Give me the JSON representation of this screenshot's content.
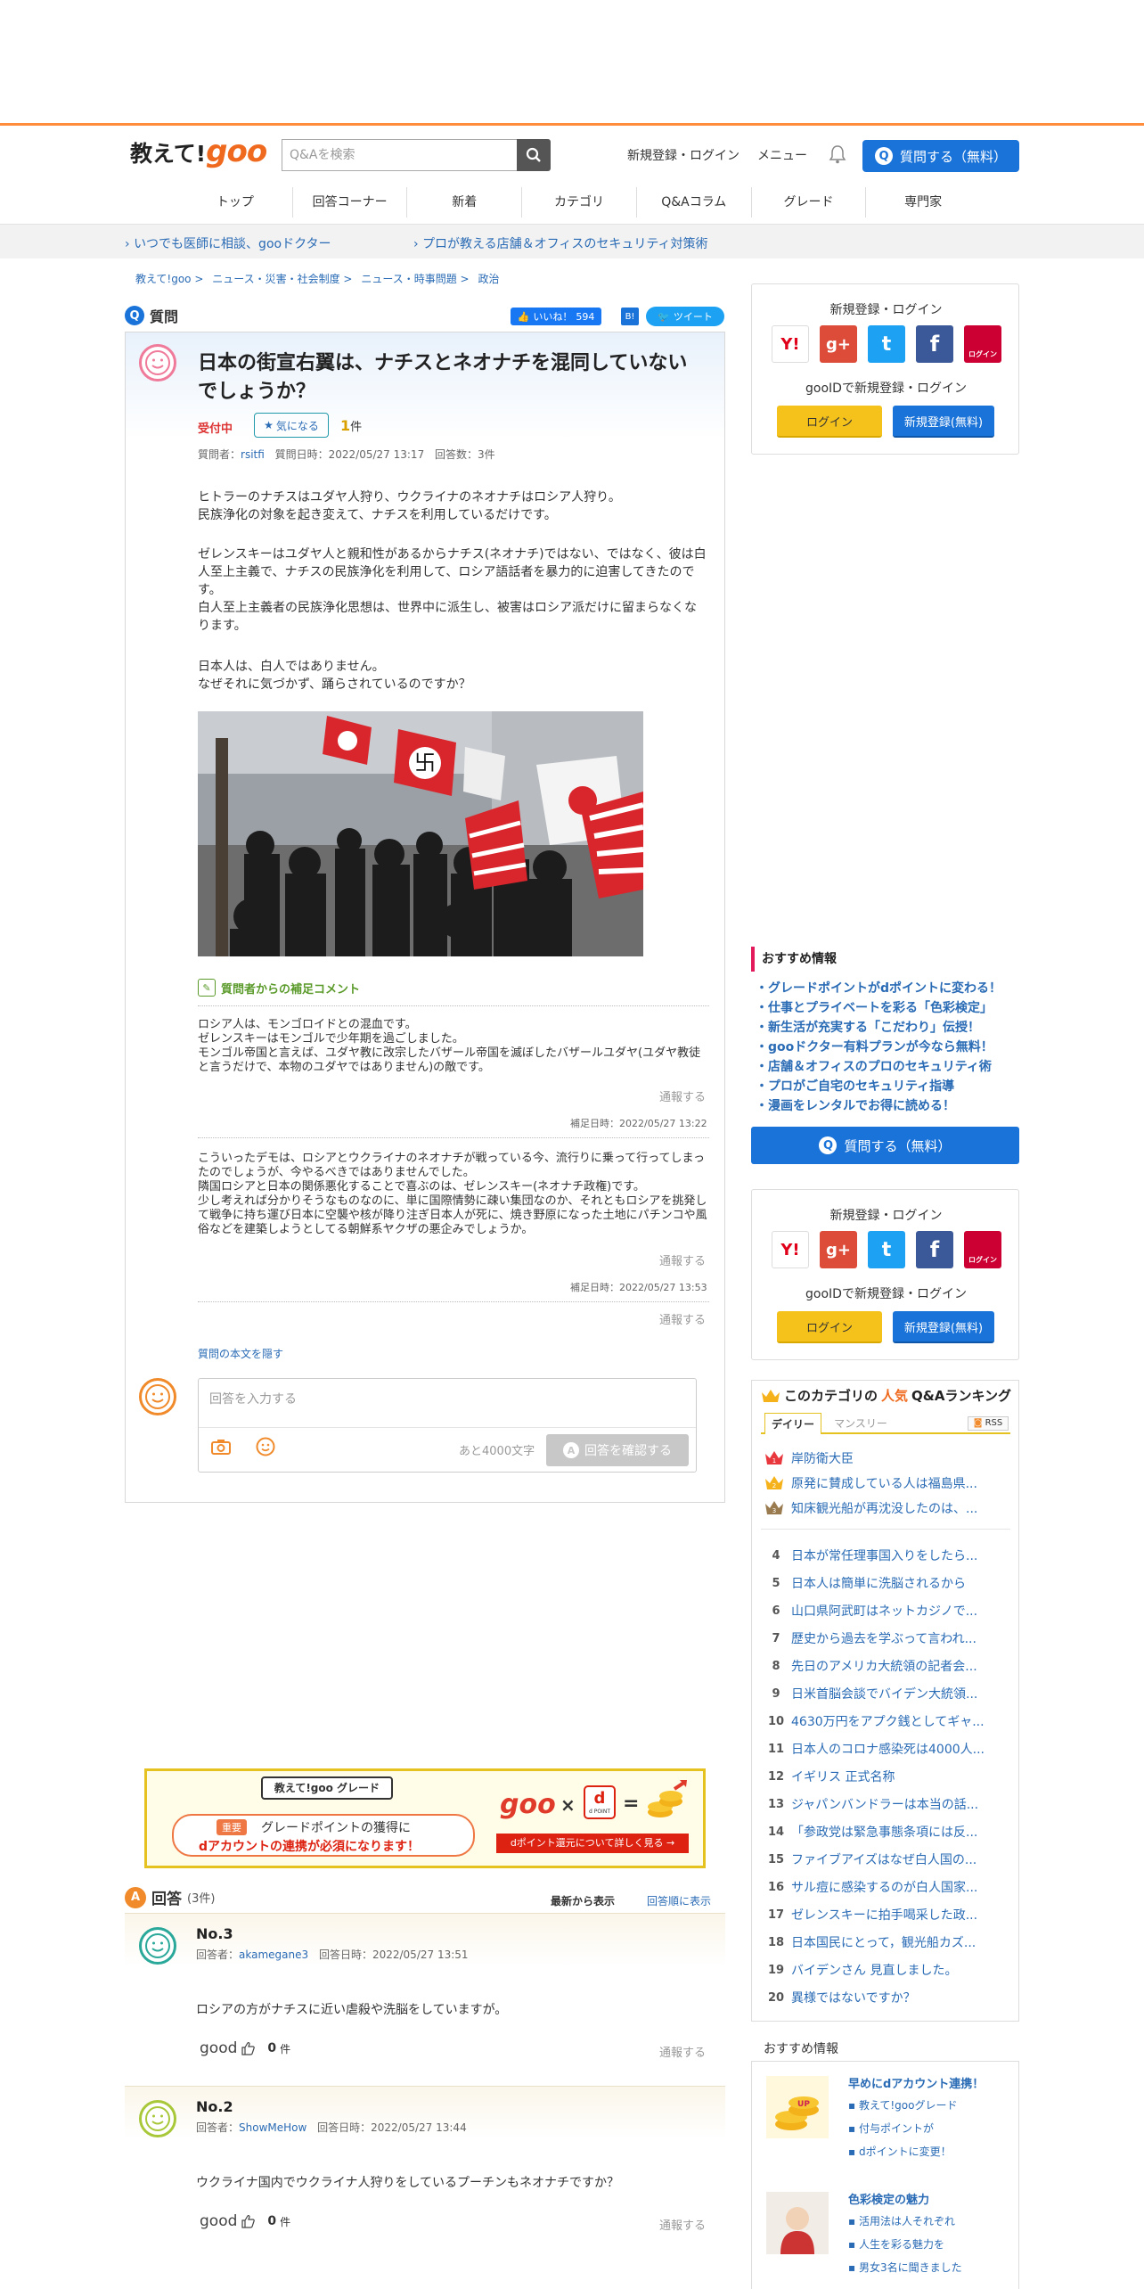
{
  "header": {
    "logo_text": "教えて!",
    "logo_goo": "goo",
    "search_placeholder": "Q&Aを検索",
    "login_label": "新規登録・ログイン",
    "menu_label": "メニュー",
    "ask_label": "質問する（無料）"
  },
  "gnav": [
    "トップ",
    "回答コーナー",
    "新着",
    "カテゴリ",
    "Q&Aコラム",
    "グレード",
    "専門家"
  ],
  "subbar": [
    "いつでも医師に相談、gooドクター",
    "プロが教える店舗＆オフィスのセキュリティ対策術"
  ],
  "breadcrumb": [
    "教えて!goo >",
    "ニュース・災害・社会制度 >",
    "ニュース・時事問題 >",
    "政治"
  ],
  "question": {
    "heading": "質問",
    "like_label": "いいね！",
    "like_count": "594",
    "hatena_label": "B!",
    "tweet_label": "ツイート",
    "title": "日本の街宣右翼は、ナチスとネオナチを混同していないでしょうか？",
    "status": "受付中",
    "watch_label": "気になる",
    "watch_count": "1",
    "watch_unit": "件",
    "meta_asker_label": "質問者：",
    "meta_asker": "rsitfi",
    "meta_date": "質問日時：2022/05/27 13:17",
    "meta_answers": "回答数：3件",
    "body1": "ヒトラーのナチスはユダヤ人狩り、ウクライナのネオナチはロシア人狩り。\n民族浄化の対象を起き変えて、ナチスを利用しているだけです。",
    "body2": "ゼレンスキーはユダヤ人と親和性があるからナチス(ネオナチ)ではない、ではなく、彼は白人至上主義で、ナチスの民族浄化を利用して、ロシア語話者を暴力的に迫害してきたのです。\n白人至上主義者の民族浄化思想は、世界中に派生し、被害はロシア派だけに留まらなくなります。",
    "body3": "日本人は、白人ではありません。\nなぜそれに気づかず、踊らされているのですか？",
    "supplement_heading": "質問者からの補足コメント",
    "supp1": "ロシア人は、モンゴロイドとの混血です。\nゼレンスキーはモンゴルで少年期を過ごしました。\nモンゴル帝国と言えば、ユダヤ教に改宗したバザール帝国を滅ぼしたバザールユダヤ(ユダヤ教徒と言うだけで、本物のユダヤではありません)の敵です。",
    "supp1_date": "補足日時：2022/05/27 13:22",
    "supp2": "こういったデモは、ロシアとウクライナのネオナチが戦っている今、流行りに乗って行ってしまったのでしょうが、今やるべきではありませんでした。\n隣国ロシアと日本の関係悪化することで喜ぶのは、ゼレンスキー(ネオナチ政権)です。\n少し考えれば分かりそうなものなのに、単に国際情勢に疎い集団なのか、それともロシアを挑発して戦争に持ち運び日本に空襲や核が降り注ぎ日本人が死に、焼き野原になった土地にパチンコや風俗などを建築しようとしてる朝鮮系ヤクザの悪企みでしょうか。",
    "supp2_date": "補足日時：2022/05/27 13:53",
    "report_label": "通報する",
    "hide_label": "質問の本文を隠す",
    "reply_placeholder": "回答を入力する",
    "reply_limit": "あと4000文字",
    "reply_confirm": "回答を確認する"
  },
  "grade_banner": {
    "logo": "教えて!goo グレード",
    "badge": "重要",
    "line1": "グレードポイントの獲得に",
    "line2": "dアカウントの連携が必須になります！",
    "goo": "goo",
    "times": "×",
    "equals": "=",
    "dpoint": "d POINT",
    "cta": "dポイント還元について詳しく見る →",
    "up": "UP"
  },
  "answers": {
    "heading": "回答",
    "count": "(3件)",
    "sort_new": "最新から表示",
    "sort_old": "回答順に表示",
    "items": [
      {
        "no": "No.3",
        "user_label": "回答者：",
        "user": "akamegane3",
        "date": "回答日時：2022/05/27 13:51",
        "text": "ロシアの方がナチスに近い虐殺や洗脳をしていますが。",
        "good_label": "good",
        "good_count": "0",
        "good_unit": "件",
        "report": "通報する"
      },
      {
        "no": "No.2",
        "user_label": "回答者：",
        "user": "ShowMeHow",
        "date": "回答日時：2022/05/27 13:44",
        "text": "ウクライナ国内でウクライナ人狩りをしているプーチンもネオナチですか？",
        "good_label": "good",
        "good_count": "0",
        "good_unit": "件",
        "report": "通報する"
      }
    ]
  },
  "sidebar": {
    "login_title": "新規登録・ログイン",
    "gooid_title": "gooIDで新規登録・ログイン",
    "login_btn": "ログイン",
    "register_btn": "新規登録(無料)",
    "sns": {
      "yahoo": "Y!",
      "google": "g+",
      "twitter": "t",
      "facebook": "f",
      "docomo": "ログイン"
    },
    "rec_heading": "おすすめ情報",
    "rec_items": [
      "・グレードポイントがdポイントに変わる！",
      "・仕事とプライベートを彩る「色彩検定」",
      "・新生活が充実する「こだわり」伝授！",
      "・gooドクター有料プランが今なら無料！",
      "・店舗＆オフィスのプロのセキュリティ術",
      "・プロがご自宅のセキュリティ指導",
      "・漫画をレンタルでお得に読める！"
    ],
    "ask_label": "質問する（無料）",
    "ranking_prefix": "このカテゴリの",
    "ranking_hl": "人気",
    "ranking_suffix": "Q&Aランキング",
    "tab_daily": "デイリー",
    "tab_monthly": "マンスリー",
    "rss": "RSS",
    "ranking": [
      {
        "n": "1",
        "t": "岸防衛大臣"
      },
      {
        "n": "2",
        "t": "原発に賛成している人は福島県..."
      },
      {
        "n": "3",
        "t": "知床観光船が再沈没したのは、..."
      },
      {
        "n": "4",
        "t": "日本が常任理事国入りをしたら..."
      },
      {
        "n": "5",
        "t": "日本人は簡単に洗脳されるから"
      },
      {
        "n": "6",
        "t": "山口県阿武町はネットカジノで..."
      },
      {
        "n": "7",
        "t": "歴史から過去を学ぶって言われ..."
      },
      {
        "n": "8",
        "t": "先日のアメリカ大統領の記者会..."
      },
      {
        "n": "9",
        "t": "日米首脳会談でバイデン大統領..."
      },
      {
        "n": "10",
        "t": "4630万円をアプク銭としてギャ..."
      },
      {
        "n": "11",
        "t": "日本人のコロナ感染死は4000人..."
      },
      {
        "n": "12",
        "t": "イギリス 正式名称"
      },
      {
        "n": "13",
        "t": "ジャパンバンドラーは本当の話..."
      },
      {
        "n": "14",
        "t": "「参政党は緊急事態条項には反..."
      },
      {
        "n": "15",
        "t": "ファイブアイズはなぜ白人国の..."
      },
      {
        "n": "16",
        "t": "サル痘に感染するのが白人国家..."
      },
      {
        "n": "17",
        "t": "ゼレンスキーに拍手喝采した政..."
      },
      {
        "n": "18",
        "t": "日本国民にとって，観光船カズ..."
      },
      {
        "n": "19",
        "t": "バイデンさん 見直しました。"
      },
      {
        "n": "20",
        "t": "異様ではないですか？"
      }
    ],
    "rec2_heading": "おすすめ情報",
    "rec2": [
      {
        "title": "早めにdアカウント連携！",
        "subs": [
          "教えて!gooグレード",
          "付与ポイントが",
          "dポイントに変更！"
        ]
      },
      {
        "title": "色彩検定の魅力",
        "subs": [
          "活用法は人それぞれ",
          "人生を彩る魅力を",
          "男女3名に聞きました"
        ]
      }
    ]
  },
  "colors": {
    "accent_orange": "#ef6a1e",
    "brand_blue": "#1a73d9",
    "login_yellow": "#f5c21b"
  }
}
